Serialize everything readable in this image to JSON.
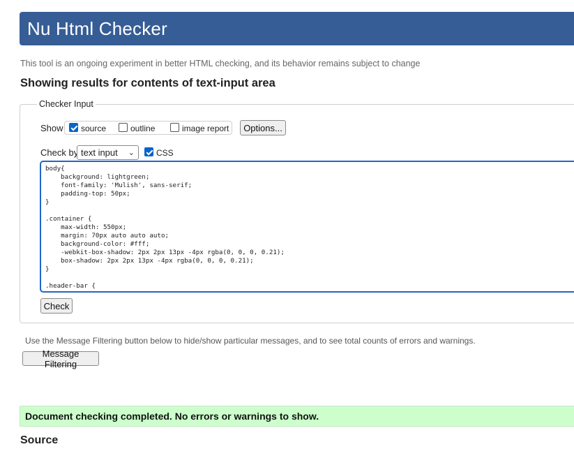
{
  "header": {
    "title": "Nu Html Checker"
  },
  "intro_text": "This tool is an ongoing experiment in better HTML checking, and its behavior remains subject to change",
  "results_heading": "Showing results for contents of text-input area",
  "checker_input": {
    "legend": "Checker Input",
    "show_label": "Show",
    "show_options": [
      {
        "label": "source",
        "checked": true
      },
      {
        "label": "outline",
        "checked": false
      },
      {
        "label": "image report",
        "checked": false
      }
    ],
    "options_button": "Options...",
    "check_by_label": "Check by",
    "check_by_value": "text input",
    "css_label": "CSS",
    "css_checked": true,
    "textarea_content": "body{\n    background: lightgreen;\n    font-family: 'Mulish', sans-serif;\n    padding-top: 50px;\n}\n\n.container {\n    max-width: 550px;\n    margin: 70px auto auto auto;\n    background-color: #fff;\n    -webkit-box-shadow: 2px 2px 13px -4px rgba(0, 0, 0, 0.21);\n    box-shadow: 2px 2px 13px -4px rgba(0, 0, 0, 0.21);\n}\n\n.header-bar {",
    "check_button": "Check"
  },
  "filter_note": "Use the Message Filtering button below to hide/show particular messages, and to see total counts of errors and warnings.",
  "message_filtering_button": "Message Filtering",
  "success_message": "Document checking completed. No errors or warnings to show.",
  "source_heading": "Source",
  "colors": {
    "header_bg": "#365d95",
    "success_bg": "#ccffcc",
    "accent": "#0b63c9"
  }
}
